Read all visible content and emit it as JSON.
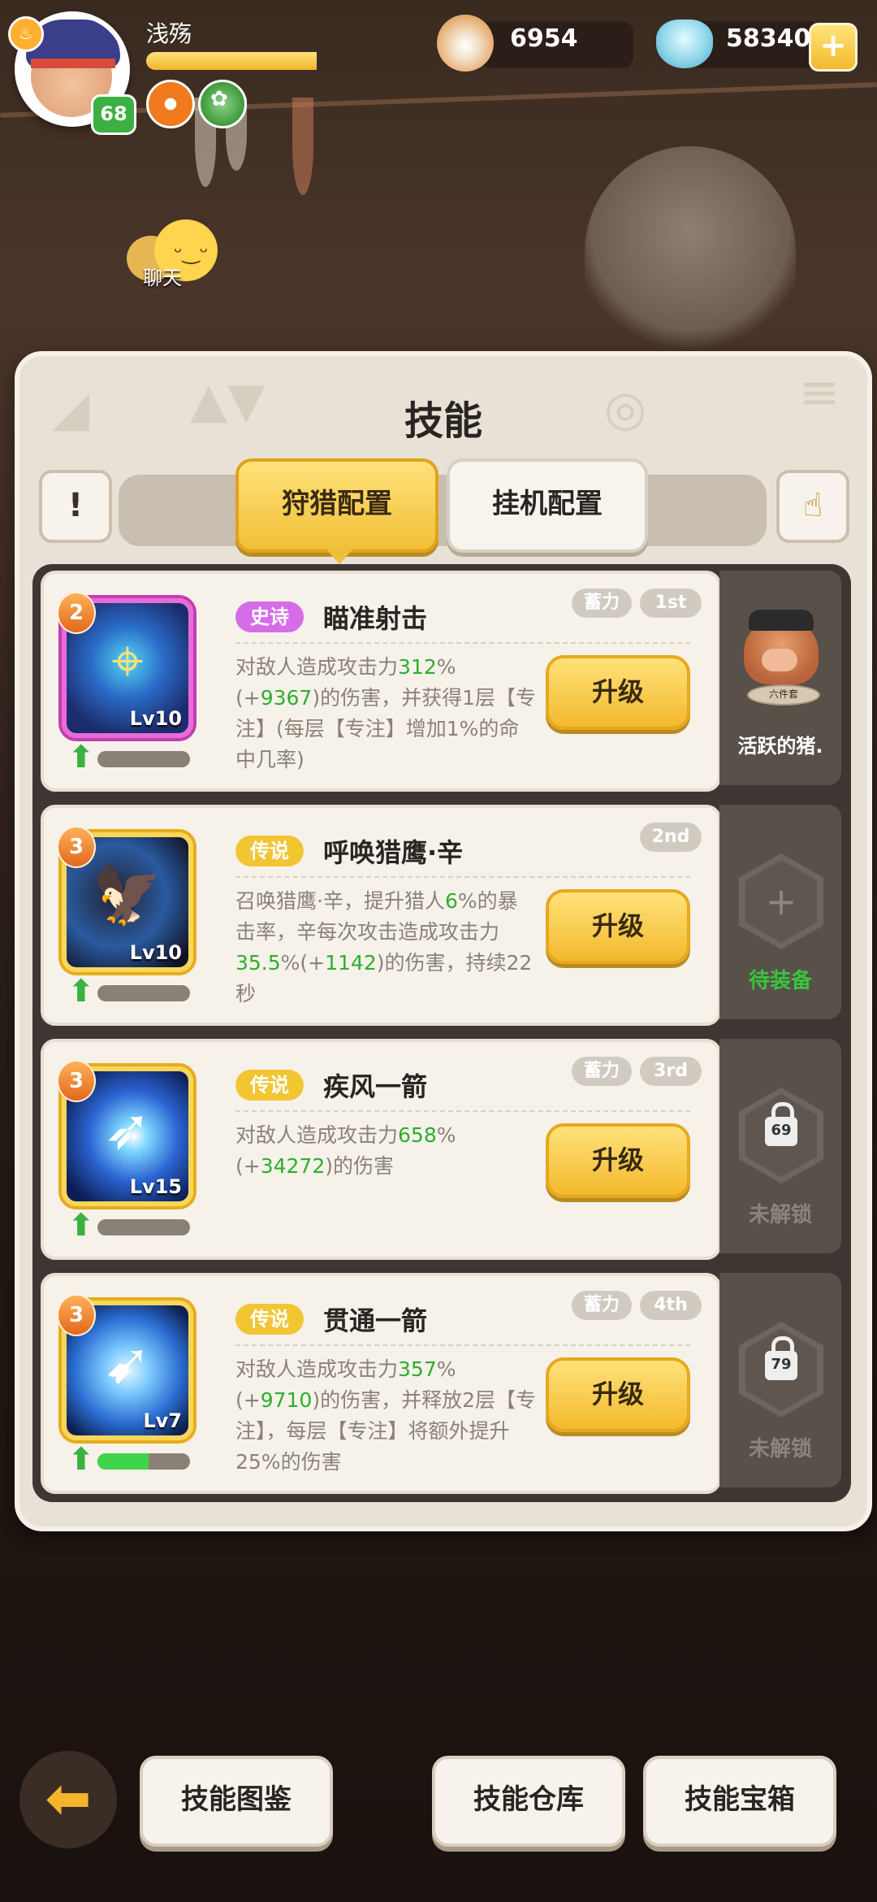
{
  "player": {
    "name": "浅殇",
    "level": "68",
    "xp_fraction": 0.93
  },
  "currencies": {
    "shells": "6954",
    "gems": "58340",
    "add_label": "+"
  },
  "chat": {
    "label": "聊天"
  },
  "panel": {
    "title": "技能",
    "info_label": "!",
    "tabs": [
      "狩猎配置",
      "挂机配置"
    ],
    "active_tab": 0
  },
  "skills": [
    {
      "star": "2",
      "lv": "Lv10",
      "rarity": "史诗",
      "name": "瞄准射击",
      "tags": [
        "蓄力",
        "1st"
      ],
      "desc_parts": [
        "对敌人造成攻击力",
        "312",
        "%(+",
        "9367",
        ")的伤害，并获得1层【专注】(每层【专注】增加1%的命中几率)"
      ],
      "progress": 0.0,
      "upgrade": "升级"
    },
    {
      "star": "3",
      "lv": "Lv10",
      "rarity": "传说",
      "name": "呼唤猎鹰·辛",
      "tags": [
        "2nd"
      ],
      "desc_parts": [
        "召唤猎鹰·辛，提升猎人",
        "6",
        "%的暴击率，辛每次攻击造成攻击力",
        "35.5",
        "%(+",
        "1142",
        ")的伤害，持续22秒"
      ],
      "progress": 0.0,
      "upgrade": "升级"
    },
    {
      "star": "3",
      "lv": "Lv15",
      "rarity": "传说",
      "name": "疾风一箭",
      "tags": [
        "蓄力",
        "3rd"
      ],
      "desc_parts": [
        "对敌人造成攻击力",
        "658",
        "%(+",
        "34272",
        ")的伤害"
      ],
      "progress": 0.0,
      "upgrade": "升级"
    },
    {
      "star": "3",
      "lv": "Lv7",
      "rarity": "传说",
      "name": "贯通一箭",
      "tags": [
        "蓄力",
        "4th"
      ],
      "desc_parts": [
        "对敌人造成攻击力",
        "357",
        "%(+",
        "9710",
        ")的伤害，并释放2层【专注】，每层【专注】将额外提升25%的伤害"
      ],
      "progress": 0.55,
      "upgrade": "升级"
    }
  ],
  "side_slots": [
    {
      "type": "pet",
      "label": "活跃的猪.",
      "stand_text": "六件套"
    },
    {
      "type": "empty",
      "label": "待装备"
    },
    {
      "type": "locked",
      "lock_level": "69",
      "label": "未解锁"
    },
    {
      "type": "locked",
      "lock_level": "79",
      "label": "未解锁"
    }
  ],
  "bottom": {
    "buttons": [
      "技能图鉴",
      "技能仓库",
      "技能宝箱"
    ]
  },
  "icons": {
    "back": "back-arrow-icon",
    "shell": "shell-currency-icon",
    "gem": "gem-currency-icon",
    "hand": "tap-hand-icon",
    "info": "info-icon",
    "upgrade": "level-up-arrow-icon"
  }
}
